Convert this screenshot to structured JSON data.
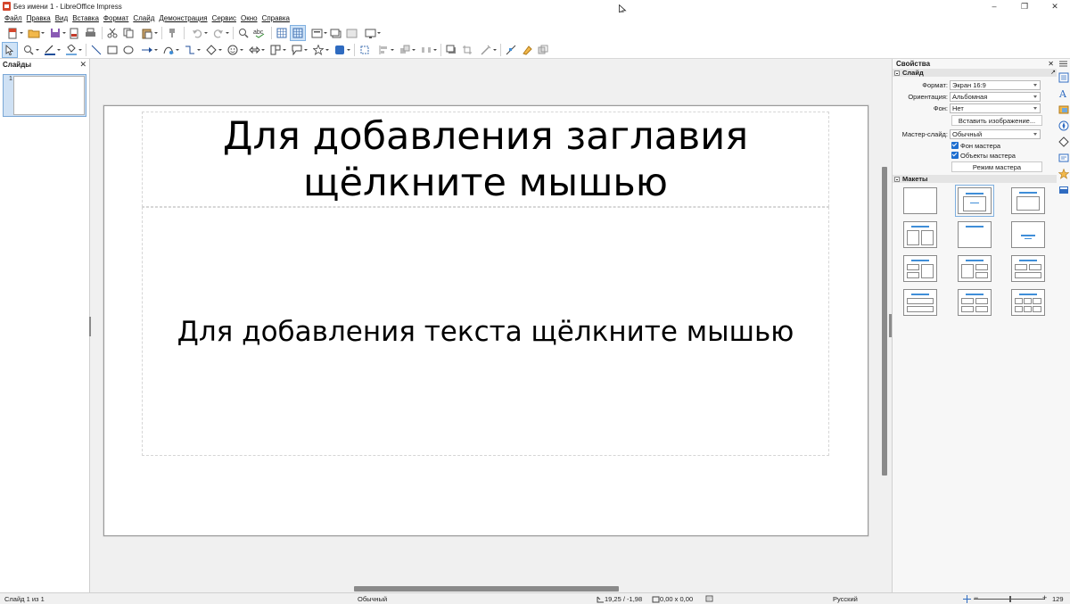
{
  "window": {
    "title": "Без имени 1 - LibreOffice Impress",
    "controls": [
      "–",
      "❐",
      "✕"
    ]
  },
  "menu": [
    "Файл",
    "Правка",
    "Вид",
    "Вставка",
    "Формат",
    "Слайд",
    "Демонстрация",
    "Сервис",
    "Окно",
    "Справка"
  ],
  "slides_pane": {
    "title": "Слайды",
    "slide_number": "1"
  },
  "slide": {
    "title_placeholder": "Для добавления заглавия щёлкните мышью",
    "body_placeholder": "Для добавления текста щёлкните мышью"
  },
  "sidebar": {
    "title": "Свойства",
    "section_slide": "Слайд",
    "format_label": "Формат:",
    "format_value": "Экран 16:9",
    "orientation_label": "Ориентация:",
    "orientation_value": "Альбомная",
    "background_label": "Фон:",
    "background_value": "Нет",
    "insert_image_button": "Вставить изображение...",
    "master_slide_label": "Мастер-слайд:",
    "master_slide_value": "Обычный",
    "master_background_checkbox": "Фон мастера",
    "master_objects_checkbox": "Объекты мастера",
    "master_mode_button": "Режим мастера",
    "section_layouts": "Макеты"
  },
  "statusbar": {
    "slide_info": "Слайд 1 из 1",
    "master_name": "Обычный",
    "position": "19,25 / -1,98",
    "size": "0,00 x 0,00",
    "language": "Русский",
    "zoom": "129 %"
  },
  "colors": {
    "accent": "#3f8ed8",
    "checkbox": "#1e6fd0",
    "app_icon": "#d4462c"
  }
}
